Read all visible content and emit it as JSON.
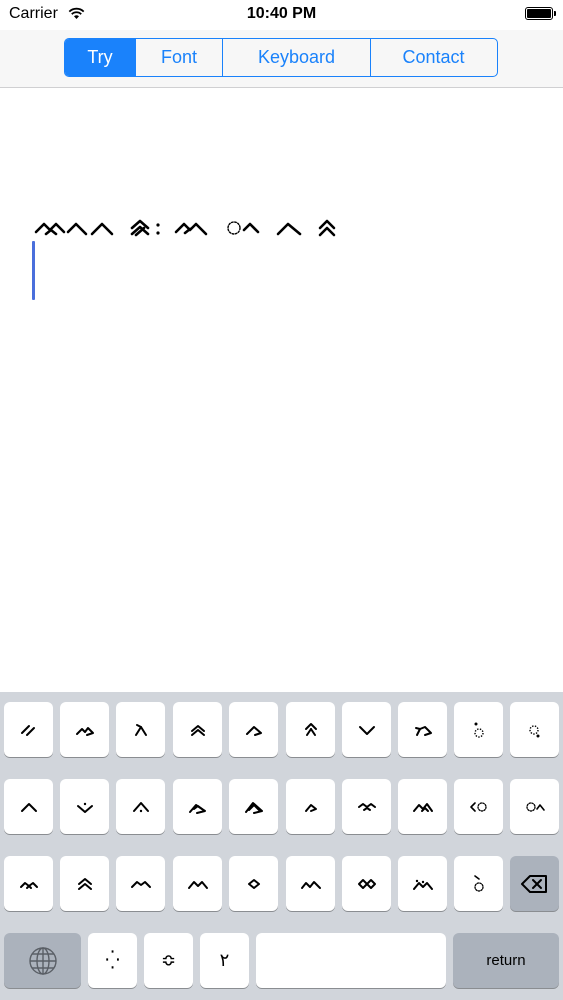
{
  "status_bar": {
    "carrier": "Carrier",
    "time": "10:40 PM"
  },
  "nav": {
    "tabs": [
      {
        "label": "Try",
        "active": true
      },
      {
        "label": "Font",
        "active": false
      },
      {
        "label": "Keyboard",
        "active": false
      },
      {
        "label": "Contact",
        "active": false
      }
    ]
  },
  "colors": {
    "accent": "#1a82fb",
    "caret": "#4a6fdc",
    "keyboard_bg": "#d1d5db",
    "key_bg": "#ffffff",
    "dark_key_bg": "#abb2bc"
  },
  "text_area": {
    "content_glyphs": [
      "double-wave",
      "caret",
      "caret",
      "double-caret",
      "colon",
      "double-wave",
      "dotted-circle-caret",
      "caret",
      "double-caret"
    ]
  },
  "keyboard": {
    "row1": [
      "double-slash",
      "wave-hook",
      "lambda",
      "double-caret-small",
      "hook",
      "caret-tail",
      "v",
      "lambda-hook",
      "dot-circle",
      "circle-dot"
    ],
    "row2": [
      "caret",
      "v-dot",
      "caret-dot",
      "double-hook",
      "triple-hook",
      "small-hook",
      "wave-tilde",
      "mountain-double",
      "lt-circle",
      "circle-caret"
    ],
    "row3": [
      "mountain-small",
      "double-caret",
      "wave-caret",
      "m-wave",
      "diamond",
      "m-wave-2",
      "infinity",
      "m-dots",
      "hook-circle"
    ],
    "row4_chars": [
      "⁛",
      "≎",
      "٢"
    ],
    "delete_icon": "delete-icon",
    "globe_icon": "globe-icon",
    "return_label": "return"
  }
}
